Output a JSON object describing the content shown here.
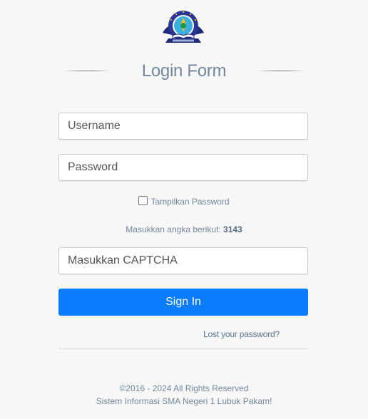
{
  "header": {
    "logo_icon": "school-emblem-icon",
    "title": "Login Form"
  },
  "form": {
    "username_placeholder": "Username",
    "password_placeholder": "Password",
    "show_password_label": "Tampilkan Password",
    "show_password_checked": false,
    "captcha_prompt": "Masukkan angka berikut:",
    "captcha_code": "3143",
    "captcha_placeholder": "Masukkan CAPTCHA",
    "signin_label": "Sign In",
    "lost_password_label": "Lost your password?"
  },
  "footer": {
    "copyright": "©2016 - 2024 All Rights Reserved",
    "system_name": "Sistem Informasi SMA Negeri 1 Lubuk Pakam!"
  },
  "colors": {
    "background": "#f7f7f7",
    "text": "#73879c",
    "primary": "#0a7cff",
    "link": "#5a738e"
  }
}
